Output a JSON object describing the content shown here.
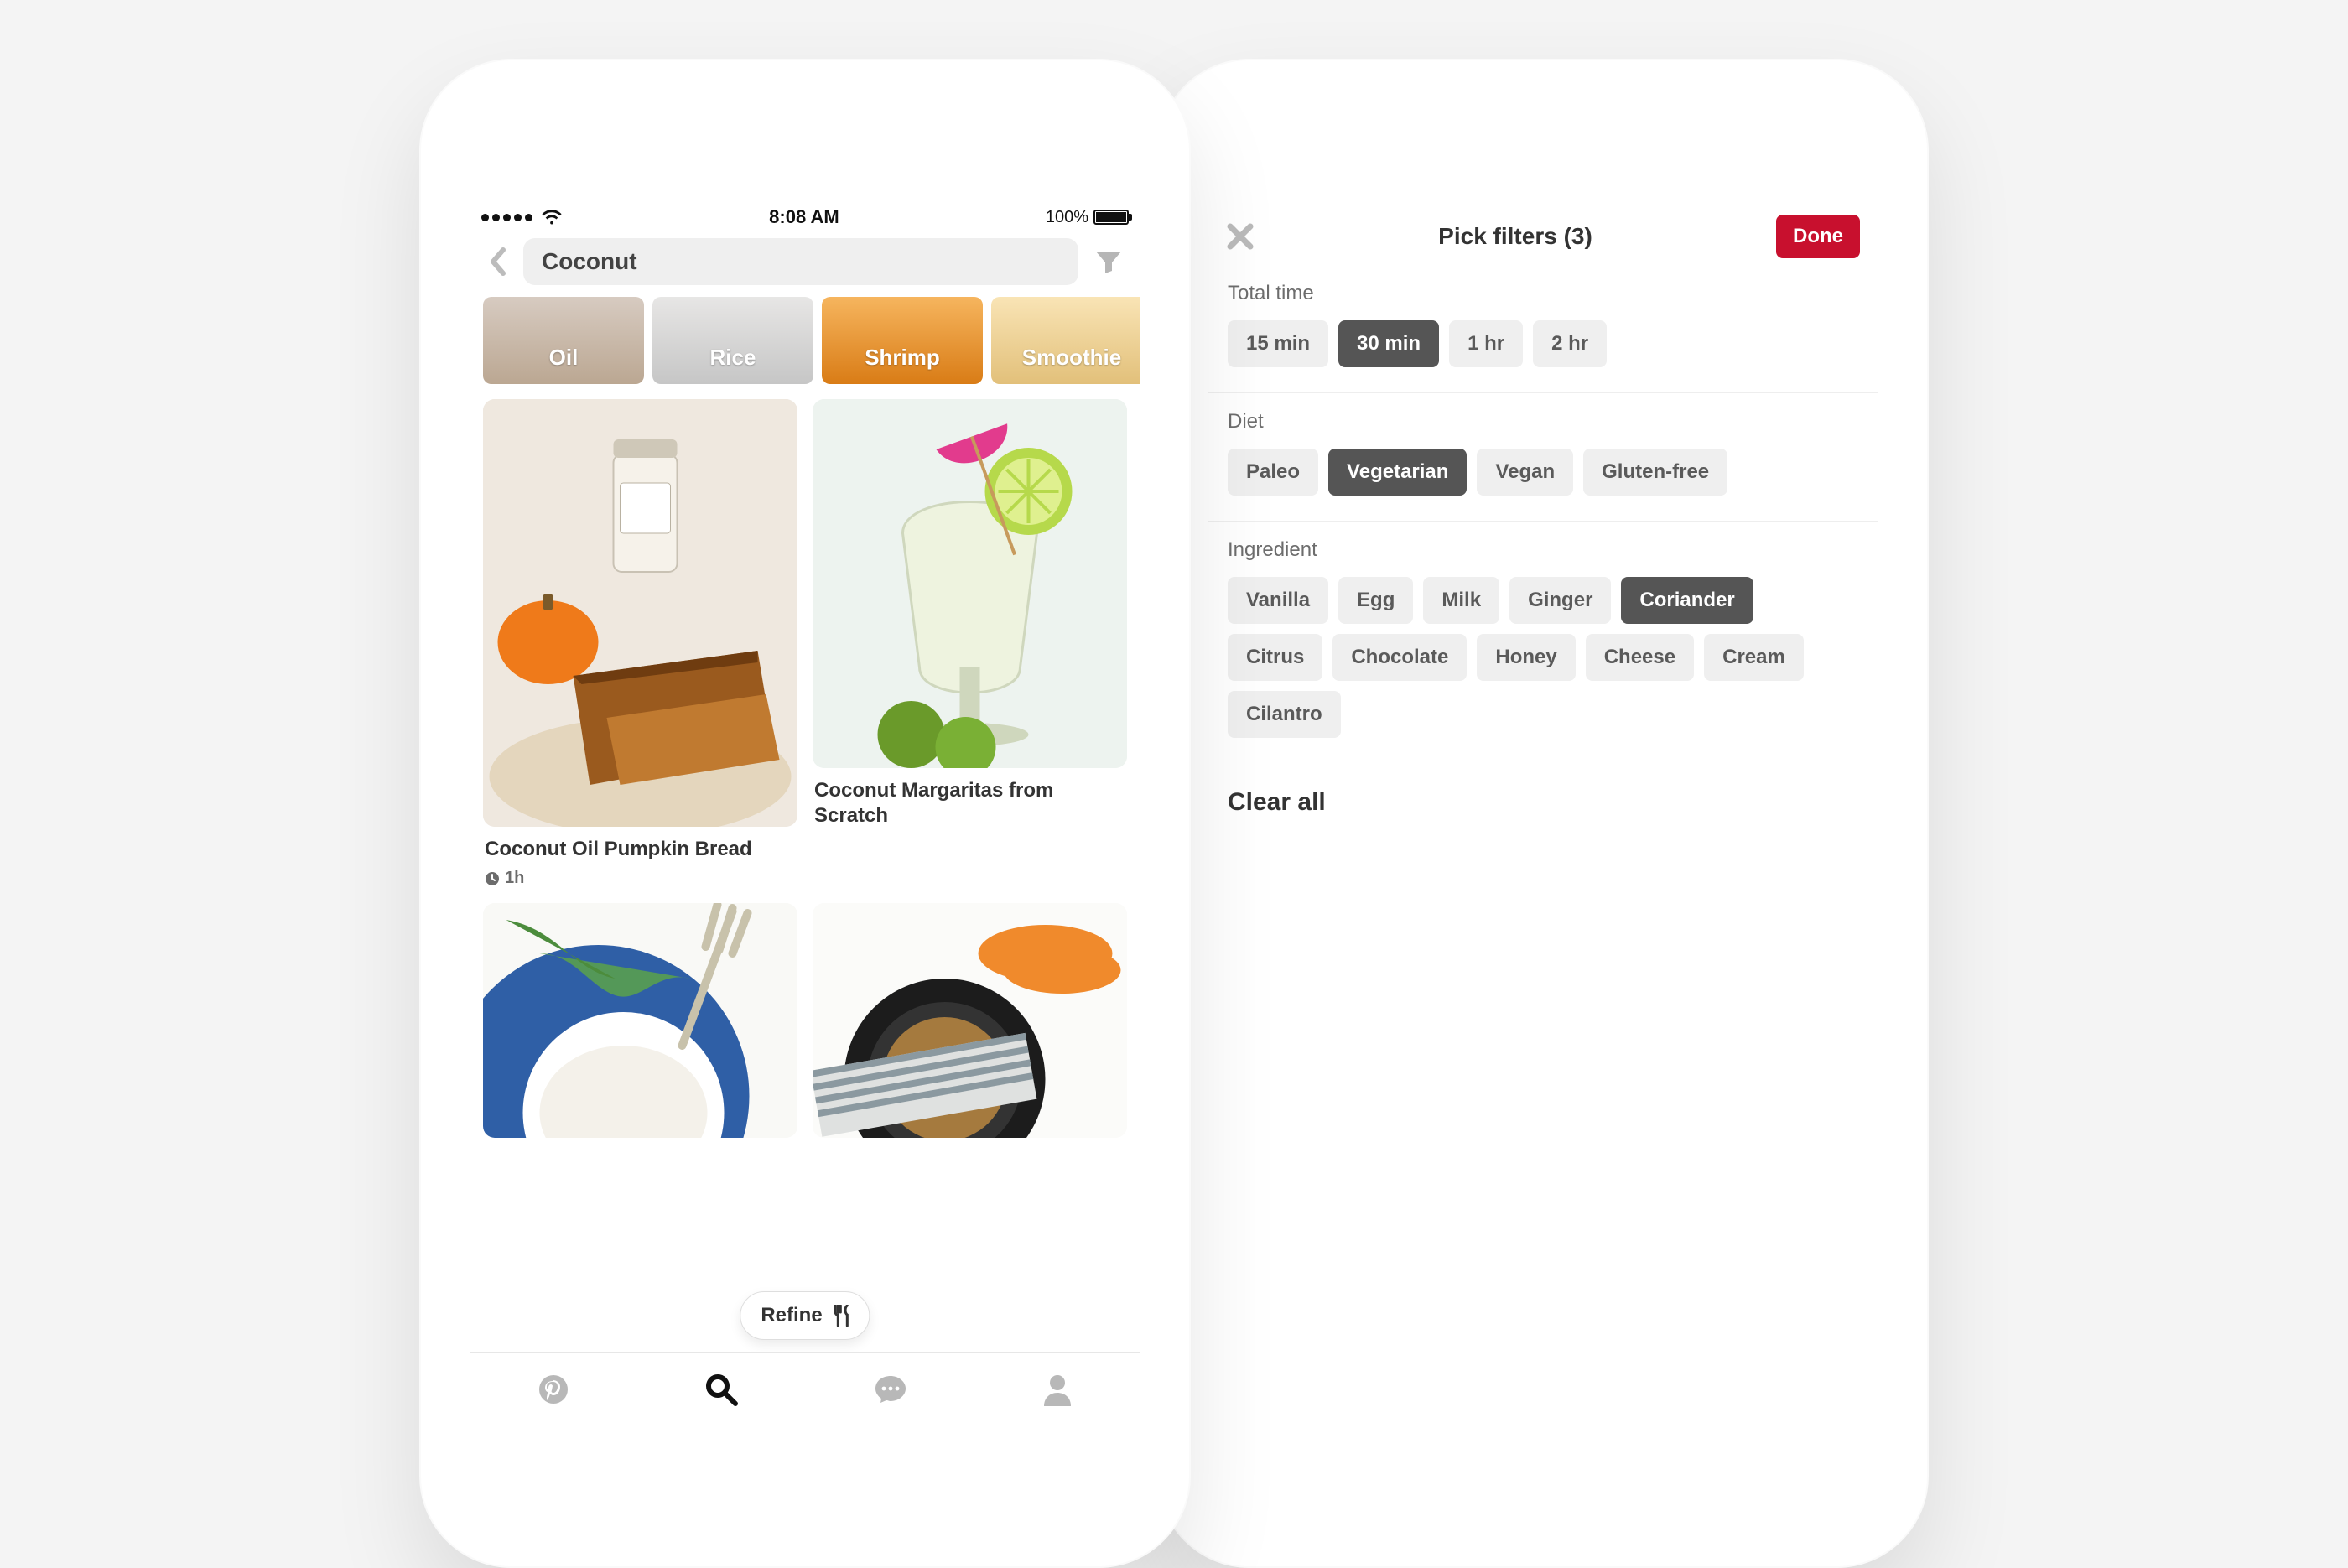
{
  "status": {
    "time": "8:08 AM",
    "battery": "100%"
  },
  "search": {
    "query": "Coconut"
  },
  "suggestions": [
    "Oil",
    "Rice",
    "Shrimp",
    "Smoothie"
  ],
  "pins": [
    {
      "title": "Coconut Oil Pumpkin Bread",
      "time": "1h"
    },
    {
      "title": "Coconut Margaritas from Scratch"
    }
  ],
  "refine_label": "Refine",
  "filters": {
    "title": "Pick filters (3)",
    "done_label": "Done",
    "clear_label": "Clear all",
    "groups": [
      {
        "label": "Total time",
        "tags": [
          {
            "label": "15 min",
            "selected": false
          },
          {
            "label": "30 min",
            "selected": true
          },
          {
            "label": "1 hr",
            "selected": false
          },
          {
            "label": "2 hr",
            "selected": false
          }
        ]
      },
      {
        "label": "Diet",
        "tags": [
          {
            "label": "Paleo",
            "selected": false
          },
          {
            "label": "Vegetarian",
            "selected": true
          },
          {
            "label": "Vegan",
            "selected": false
          },
          {
            "label": "Gluten-free",
            "selected": false
          }
        ]
      },
      {
        "label": "Ingredient",
        "tags": [
          {
            "label": "Vanilla",
            "selected": false
          },
          {
            "label": "Egg",
            "selected": false
          },
          {
            "label": "Milk",
            "selected": false
          },
          {
            "label": "Ginger",
            "selected": false
          },
          {
            "label": "Coriander",
            "selected": true
          },
          {
            "label": "Citrus",
            "selected": false
          },
          {
            "label": "Chocolate",
            "selected": false
          },
          {
            "label": "Honey",
            "selected": false
          },
          {
            "label": "Cheese",
            "selected": false
          },
          {
            "label": "Cream",
            "selected": false
          },
          {
            "label": "Cilantro",
            "selected": false
          }
        ]
      }
    ]
  }
}
